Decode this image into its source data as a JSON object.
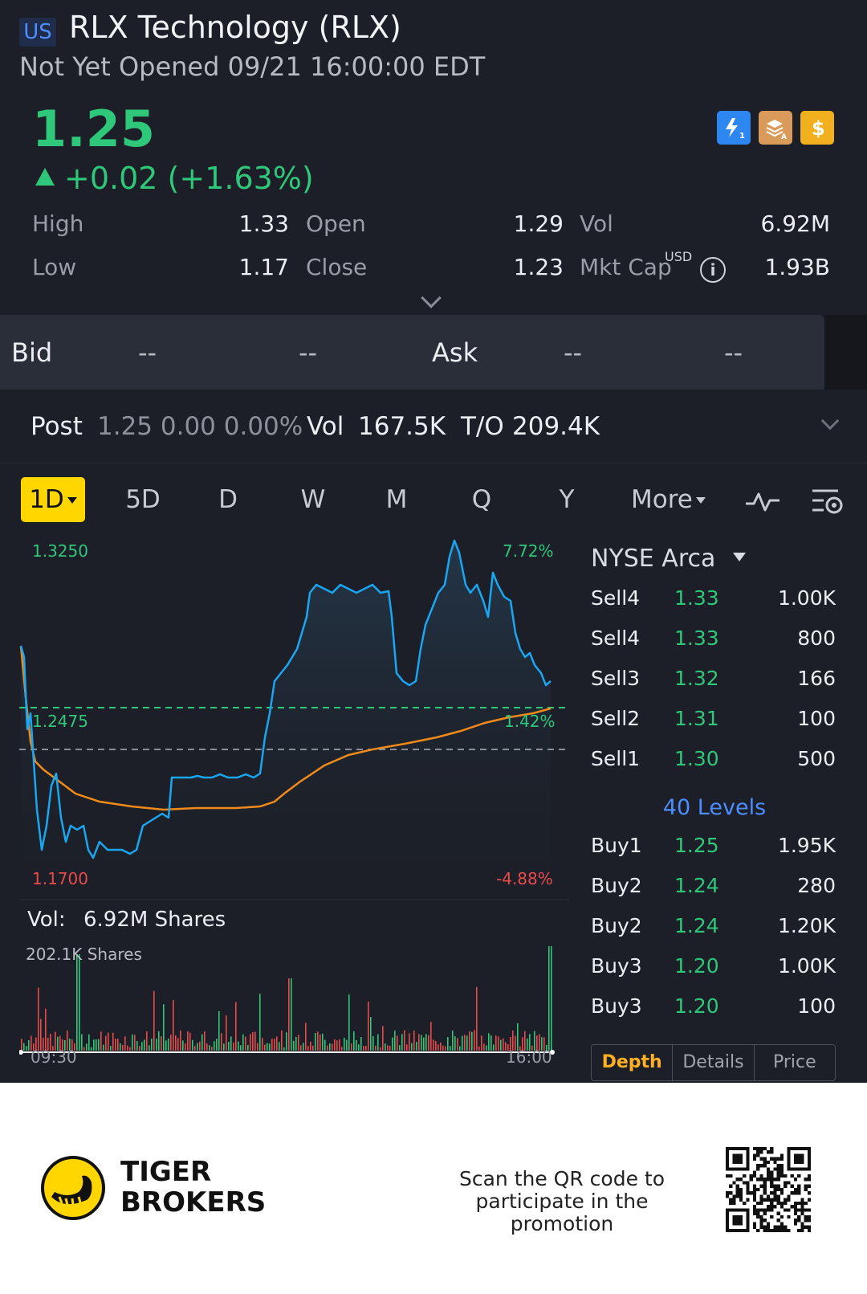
{
  "header": {
    "market": "US",
    "title": "RLX Technology (RLX)",
    "status": "Not Yet Opened 09/21 16:00:00 EDT",
    "price": "1.25",
    "change": "+0.02 (+1.63%)",
    "badge_icons": [
      "lightning-level1-icon",
      "stack-a-icon",
      "dollar-icon"
    ],
    "usd_sup": "USD",
    "stats": {
      "high_label": "High",
      "high": "1.33",
      "low_label": "Low",
      "low": "1.17",
      "open_label": "Open",
      "open": "1.29",
      "close_label": "Close",
      "close": "1.23",
      "vol_label": "Vol",
      "vol": "6.92M",
      "mktcap_label": "Mkt Cap",
      "mktcap": "1.93B"
    }
  },
  "bidask": {
    "bid_label": "Bid",
    "bid_price": "--",
    "bid_size": "--",
    "ask_label": "Ask",
    "ask_price": "--",
    "ask_size": "--"
  },
  "post": {
    "label": "Post",
    "price": "1.25 0.00 0.00%",
    "vol_label": "Vol",
    "vol": "167.5K",
    "to_label": "T/O",
    "to": "209.4K"
  },
  "timeframes": [
    "1D",
    "5D",
    "D",
    "W",
    "M",
    "Q",
    "Y",
    "More"
  ],
  "chart": {
    "y_high": "1.3250",
    "y_high_pct": "7.72%",
    "y_mid": "1.2475",
    "y_mid_pct": "1.42%",
    "y_low": "1.1700",
    "y_low_pct": "-4.88%",
    "vol_label": "Vol:",
    "vol_value": "6.92M Shares",
    "vol_max": "202.1K Shares",
    "time_start": "09:30",
    "time_end": "16:00",
    "colors": {
      "price_line": "#1aa6f0",
      "avg_line": "#f08a1a",
      "up": "#2fc77a",
      "down": "#e84b4b"
    }
  },
  "chart_data": {
    "type": "line",
    "x": [
      "09:30",
      "10:00",
      "10:30",
      "11:00",
      "11:30",
      "12:00",
      "12:30",
      "13:00",
      "13:30",
      "14:00",
      "14:30",
      "15:00",
      "15:30",
      "16:00"
    ],
    "series": [],
    "ylim": [
      1.17,
      1.325
    ],
    "reference_price": 1.2475
  },
  "orderbook": {
    "exchange": "NYSE Arca",
    "rows": [
      {
        "side": "Sell4",
        "price": "1.33",
        "qty": "1.00K"
      },
      {
        "side": "Sell4",
        "price": "1.33",
        "qty": "800"
      },
      {
        "side": "Sell3",
        "price": "1.32",
        "qty": "166"
      },
      {
        "side": "Sell2",
        "price": "1.31",
        "qty": "100"
      },
      {
        "side": "Sell1",
        "price": "1.30",
        "qty": "500"
      }
    ],
    "levels": "40 Levels",
    "buys": [
      {
        "side": "Buy1",
        "price": "1.25",
        "qty": "1.95K"
      },
      {
        "side": "Buy2",
        "price": "1.24",
        "qty": "280"
      },
      {
        "side": "Buy2",
        "price": "1.24",
        "qty": "1.20K"
      },
      {
        "side": "Buy3",
        "price": "1.20",
        "qty": "1.00K"
      },
      {
        "side": "Buy3",
        "price": "1.20",
        "qty": "100"
      }
    ],
    "tabs": [
      "Depth",
      "Details",
      "Price"
    ]
  },
  "footer": {
    "brand_line1": "TIGER",
    "brand_line2": "BROKERS",
    "promo_line1": "Scan the QR code to",
    "promo_line2": "participate in the promotion"
  }
}
